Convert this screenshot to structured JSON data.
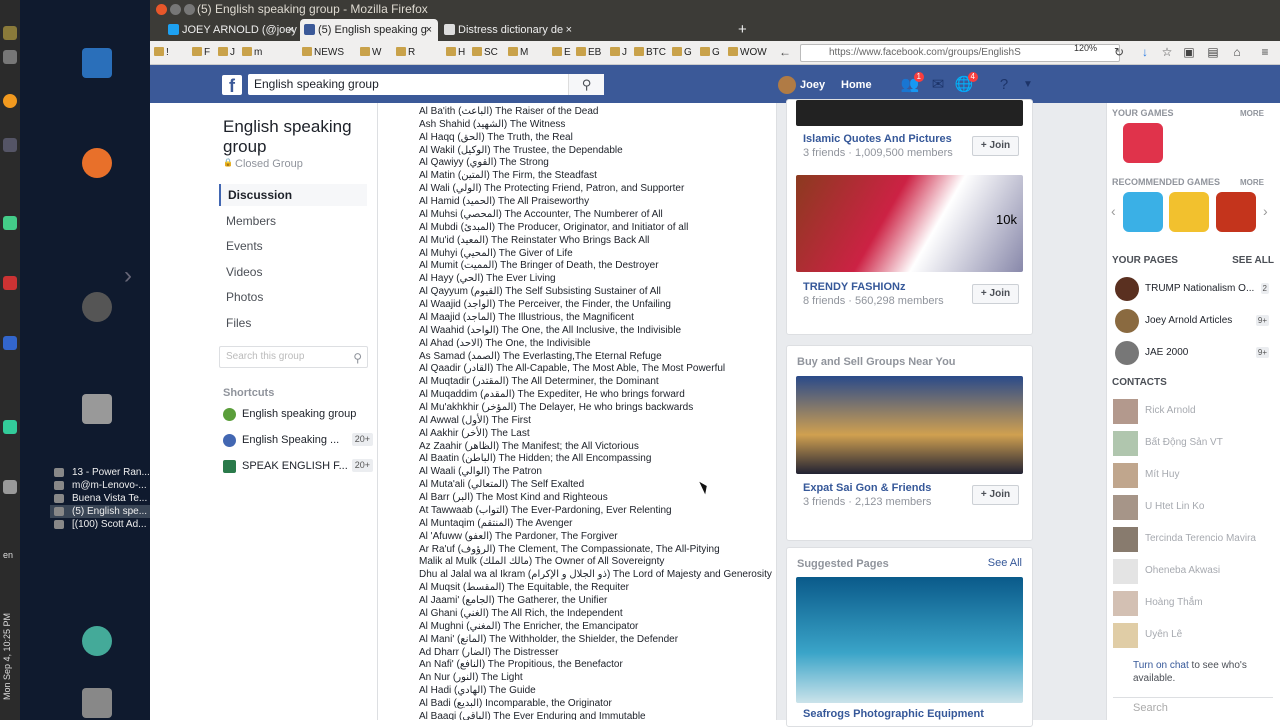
{
  "os": {
    "clock": "Mon Sep 4, 10:25 PM",
    "locale": "en",
    "taskbar": [
      "13 - Power Ran...",
      "m@m-Lenovo-...",
      "Buena Vista Te...",
      "(5) English spe...",
      "[(100) Scott Ad..."
    ]
  },
  "window": {
    "title": "(5) English speaking group - Mozilla Firefox"
  },
  "tabs": [
    {
      "label": "JOEY ARNOLD (@joey"
    },
    {
      "label": "(5) English speaking g"
    },
    {
      "label": "Distress dictionary de"
    }
  ],
  "nav": {
    "url": "https://www.facebook.com/groups/EnglishS",
    "zoom": "120%",
    "bookmarks": [
      "!",
      "F",
      "J",
      "m",
      "NEWS",
      "W",
      "R",
      "H",
      "SC",
      "M",
      "E",
      "EB",
      "J",
      "BTC",
      "G",
      "G",
      "WOW"
    ]
  },
  "fb": {
    "search_value": "English speaking group",
    "user": "Joey",
    "home": "Home",
    "friend_badge": "1",
    "notif_badge": "4"
  },
  "group": {
    "title": "English speaking group",
    "privacy": "Closed Group",
    "nav": [
      "Discussion",
      "Members",
      "Events",
      "Videos",
      "Photos",
      "Files"
    ],
    "search_placeholder": "Search this group",
    "shortcuts_head": "Shortcuts",
    "shortcuts": [
      {
        "label": "English speaking group",
        "count": ""
      },
      {
        "label": "English Speaking ...",
        "count": "20+"
      },
      {
        "label": "SPEAK ENGLISH F...",
        "count": "20+"
      }
    ]
  },
  "post_lines": [
    "Al Ba'ith (الباعث) The Raiser of the Dead",
    "Ash Shahid (الشهيد) The Witness",
    "Al Haqq (الحق) The Truth, the Real",
    "Al Wakil (الوكيل) The Trustee, the Dependable",
    "Al Qawiyy (القوي) The Strong",
    "Al Matin (المتين) The Firm, the Steadfast",
    "Al Wali (الولي) The Protecting Friend, Patron, and Supporter",
    "Al Hamid (الحميد) The All Praiseworthy",
    "Al Muhsi (المحصي) The Accounter, The Numberer of All",
    "Al Mubdi (المبدئ) The Producer, Originator, and Initiator of all",
    "Al Mu'id (المعيد) The Reinstater Who Brings Back All",
    "Al Muhyi (المحيي) The Giver of Life",
    "Al Mumit (المميت) The Bringer of Death, the Destroyer",
    "Al Hayy (الحي) The Ever Living",
    "Al Qayyum (القيوم) The Self Subsisting Sustainer of All",
    "Al Waajid (الواجد) The Perceiver, the Finder, the Unfailing",
    "Al Maajid (الماجد) The Illustrious, the Magnificent",
    "Al Waahid (الواحد) The One, the All Inclusive, the Indivisible",
    "Al Ahad (الاحد) The One, the Indivisible",
    "As Samad (الصمد) The Everlasting,The Eternal Refuge",
    "Al Qaadir (القادر) The All-Capable, The Most Able, The Most Powerful",
    "Al Muqtadir (المقتدر) The All Determiner, the Dominant",
    "Al Muqaddim (المقدم) The Expediter, He who brings forward",
    "Al Mu'akhkhir (المؤخر) The Delayer, He who brings backwards",
    "Al Awwal (الأول) The First",
    "Al Aakhir (الأخر) The Last",
    "Az Zaahir (الظاهر) The Manifest; the All Victorious",
    "Al Baatin (الباطن) The Hidden; the All Encompassing",
    "Al Waali (الوالي) The Patron",
    "Al Muta'ali (المتعالي) The Self Exalted",
    "Al Barr (البر) The Most Kind and Righteous",
    "At Tawwaab (التواب) The Ever-Pardoning, Ever Relenting",
    "Al Muntaqim (المنتقم) The Avenger",
    "Al 'Afuww (العفو) The Pardoner, The Forgiver",
    "Ar Ra'uf (الرؤوف) The Clement, The Compassionate, The All-Pitying",
    "Malik al Mulk (مالك الملك) The Owner of All Sovereignty",
    "Dhu al Jalal wa al Ikram (ذو الجلال و الإكرام) The Lord of Majesty and Generosity",
    "Al Muqsit (المقسط) The Equitable, the Requiter",
    "Al Jaami' (الجامع) The Gatherer, the Unifier",
    "Al Ghani (الغني) The All Rich, the Independent",
    "Al Mughni (المغني) The Enricher, the Emancipator",
    "Al Mani' (المانع) The Withholder, the Shielder, the Defender",
    "Ad Dharr (الضار) The Distresser",
    "An Nafi' (النافع) The Propitious, the Benefactor",
    "An Nur (النور) The Light",
    "Al Hadi (الهادي) The Guide",
    "Al Badi (البديع) Incomparable, the Originator",
    "Al Baaqi (الباقي) The Ever Enduring and Immutable"
  ],
  "suggest_groups": [
    {
      "name": "Islamic Quotes And Pictures",
      "meta": "3 friends · 1,009,500 members",
      "join": "Join"
    },
    {
      "name": "TRENDY FASHIONz",
      "meta": "8 friends · 560,298 members",
      "join": "Join",
      "img_text": "10k"
    },
    {
      "name": "Expat Sai Gon & Friends",
      "meta": "3 friends · 2,123 members",
      "join": "Join"
    }
  ],
  "buy_sell_head": "Buy and Sell Groups Near You",
  "suggested_pages_head": "Suggested Pages",
  "suggested_pages_seeall": "See All",
  "suggested_page_name": "Seafrogs Photographic Equipment",
  "sidebar": {
    "your_games": "YOUR GAMES",
    "more": "MORE",
    "recommended": "RECOMMENDED GAMES",
    "your_pages": "YOUR PAGES",
    "see_all": "SEE ALL",
    "pages": [
      {
        "name": "TRUMP Nationalism O...",
        "count": "2"
      },
      {
        "name": "Joey Arnold Articles",
        "count": "9+"
      },
      {
        "name": "JAE 2000",
        "count": "9+"
      }
    ],
    "contacts_head": "CONTACTS",
    "contacts": [
      "Rick Arnold",
      "Bất Động Sản VT",
      "Mít Huy",
      "U Htet Lin Ko",
      "Tercinda Terencio Mavira",
      "Oheneba Akwasi",
      "Hoàng Thắm",
      "Uyên Lê"
    ],
    "chat_link": "Turn on chat",
    "chat_rest": " to see who's available.",
    "search": "Search"
  }
}
